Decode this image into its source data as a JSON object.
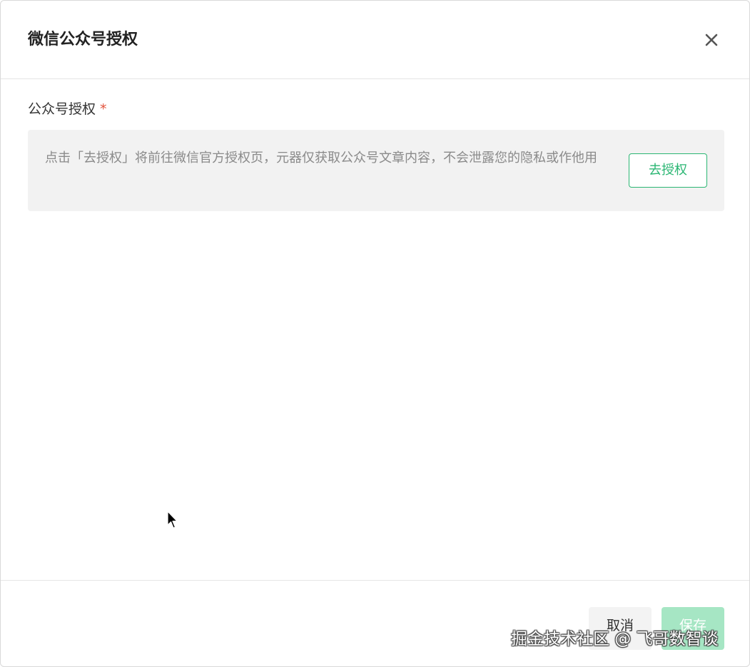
{
  "dialog": {
    "title": "微信公众号授权",
    "close_icon": "close-icon"
  },
  "form": {
    "label": "公众号授权",
    "required_mark": "*",
    "notice": "点击「去授权」将前往微信官方授权页，元器仅获取公众号文章内容，不会泄露您的隐私或作他用",
    "authorize_button": "去授权"
  },
  "footer": {
    "cancel_label": "取消",
    "save_label": "保存"
  },
  "watermark": "掘金技术社区 @ 飞哥数智谈",
  "colors": {
    "accent": "#2bb673",
    "accent_disabled": "#a6e6c4",
    "required": "#e2533c",
    "notice_bg": "#f2f2f2"
  }
}
